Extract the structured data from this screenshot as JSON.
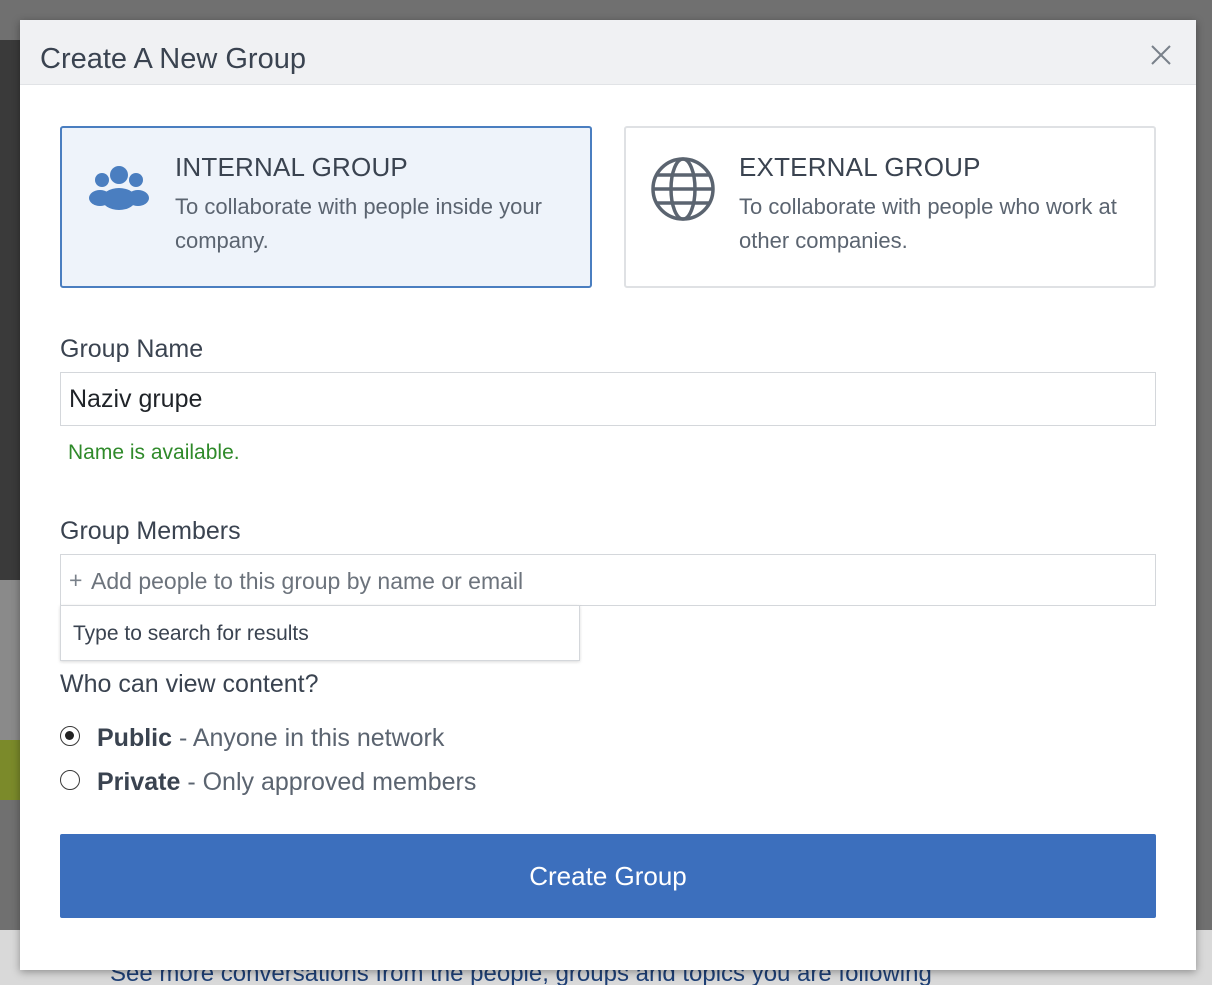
{
  "background": {
    "footer_text": "See more conversations from the people, groups and topics you are following"
  },
  "modal": {
    "title": "Create A New Group",
    "close_icon": "close-icon"
  },
  "group_types": {
    "internal": {
      "title": "INTERNAL GROUP",
      "description": "To collaborate with people inside your company.",
      "icon": "people-icon",
      "selected": true
    },
    "external": {
      "title": "EXTERNAL GROUP",
      "description": "To collaborate with people who work at other companies.",
      "icon": "globe-icon",
      "selected": false
    }
  },
  "group_name": {
    "label": "Group Name",
    "value": "Naziv grupe",
    "status": "Name is available."
  },
  "group_members": {
    "label": "Group Members",
    "plus": "+",
    "placeholder": "Add people to this group by name or email",
    "suggestion_hint": "Type to search for results"
  },
  "visibility": {
    "label": "Who can view content?",
    "options": [
      {
        "name": "Public",
        "description": " - Anyone in this network",
        "selected": true
      },
      {
        "name": "Private",
        "description": " - Only approved members",
        "selected": false
      }
    ]
  },
  "actions": {
    "create_label": "Create Group"
  },
  "colors": {
    "primary_button": "#3c6fbd",
    "selected_card_border": "#4a7ec0",
    "success_text": "#2f8a2a"
  }
}
